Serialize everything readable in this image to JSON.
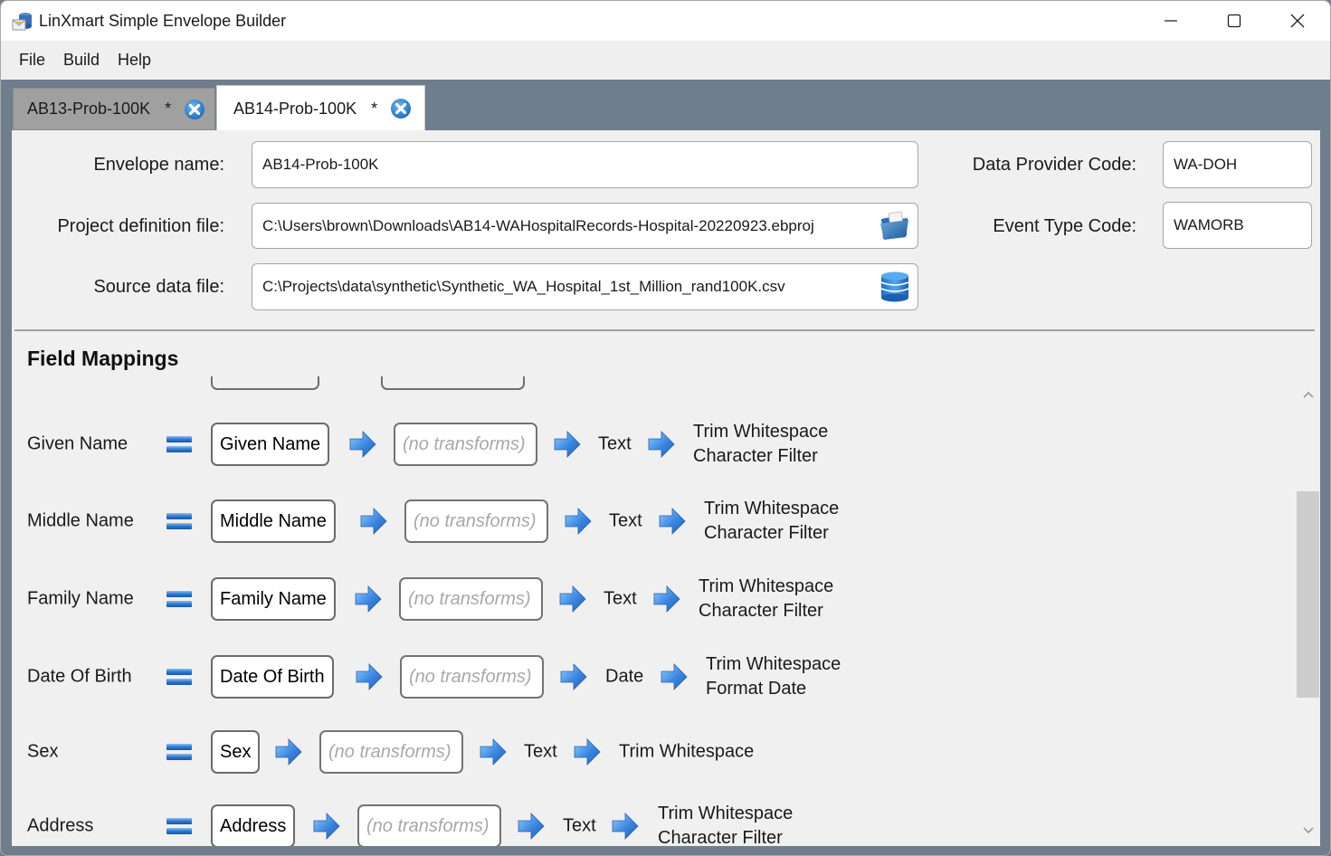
{
  "window": {
    "title": "LinXmart Simple Envelope Builder",
    "icons": {
      "app": "envelope-database-icon",
      "minimize": "minimize-icon",
      "maximize": "maximize-icon",
      "close": "close-icon"
    }
  },
  "menu": {
    "items": [
      "File",
      "Build",
      "Help"
    ]
  },
  "tabs": [
    {
      "label": "AB13-Prob-100K",
      "dirty": "*",
      "active": false,
      "close_icon": "close-circle-icon"
    },
    {
      "label": "AB14-Prob-100K",
      "dirty": "*",
      "active": true,
      "close_icon": "close-circle-icon"
    }
  ],
  "form": {
    "envelope_name": {
      "label": "Envelope name:",
      "value": "AB14-Prob-100K"
    },
    "project_file": {
      "label": "Project definition file:",
      "value": "C:\\Users\\brown\\Downloads\\AB14-WAHospitalRecords-Hospital-20220923.ebproj",
      "icon": "open-folder-icon"
    },
    "source_file": {
      "label": "Source data file:",
      "value": "C:\\Projects\\data\\synthetic\\Synthetic_WA_Hospital_1st_Million_rand100K.csv",
      "icon": "database-icon"
    },
    "data_provider_code": {
      "label": "Data Provider Code:",
      "value": "WA-DOH"
    },
    "event_type_code": {
      "label": "Event Type Code:",
      "value": "WAMORB"
    }
  },
  "field_mappings": {
    "title": "Field Mappings",
    "rows": [
      {
        "target": "Given Name",
        "source": "Given Name",
        "transforms": "(no transforms)",
        "type": "Text",
        "operations": [
          "Trim Whitespace",
          "Character Filter"
        ]
      },
      {
        "target": "Middle Name",
        "source": "Middle Name",
        "transforms": "(no transforms)",
        "type": "Text",
        "operations": [
          "Trim Whitespace",
          "Character Filter"
        ]
      },
      {
        "target": "Family Name",
        "source": "Family Name",
        "transforms": "(no transforms)",
        "type": "Text",
        "operations": [
          "Trim Whitespace",
          "Character Filter"
        ]
      },
      {
        "target": "Date Of Birth",
        "source": "Date Of Birth",
        "transforms": "(no transforms)",
        "type": "Date",
        "operations": [
          "Trim Whitespace",
          "Format Date"
        ]
      },
      {
        "target": "Sex",
        "source": "Sex",
        "transforms": "(no transforms)",
        "type": "Text",
        "operations": [
          "Trim Whitespace"
        ]
      },
      {
        "target": "Address",
        "source": "Address",
        "transforms": "(no transforms)",
        "type": "Text",
        "operations": [
          "Trim Whitespace",
          "Character Filter"
        ]
      }
    ],
    "icons": {
      "equals": "equals-icon",
      "arrow": "arrow-right-icon"
    }
  },
  "scrollbar": {
    "position_fraction": 0.42
  }
}
